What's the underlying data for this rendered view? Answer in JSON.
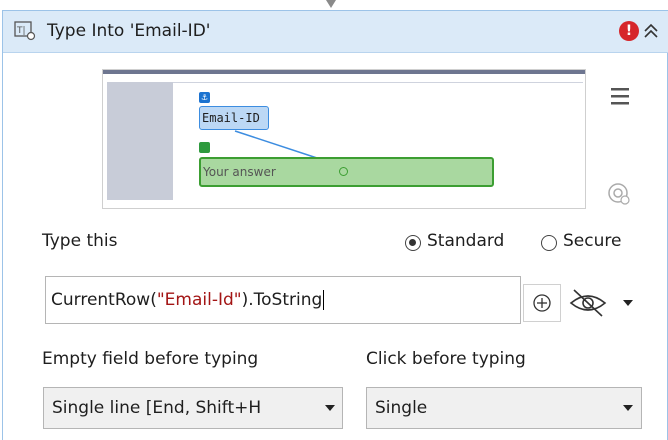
{
  "activity": {
    "title": "Type Into 'Email-ID'",
    "icons": {
      "type": "type-into-icon",
      "error": "error-icon",
      "collapse": "double-chevron-up-icon",
      "menu": "hamburger-menu-icon",
      "target": "indicate-target-icon"
    },
    "error_symbol": "!"
  },
  "preview": {
    "anchor_label": "Email-ID",
    "target_placeholder": "Your answer"
  },
  "type_this": {
    "label": "Type this",
    "mode_options": [
      "Standard",
      "Secure"
    ],
    "selected_mode": "Standard",
    "value_prefix": "CurrentRow(",
    "value_string": "\"Email-Id\"",
    "value_suffix": ").ToString"
  },
  "empty_field": {
    "label": "Empty field before typing",
    "selected": "Single line [End, Shift+H"
  },
  "click_before": {
    "label": "Click before typing",
    "selected": "Single"
  },
  "colors": {
    "header_bg": "#dbeaf8",
    "error": "#d6262b",
    "anchor": "#3d8de0",
    "target": "#3c9e32",
    "string_literal": "#a31515"
  }
}
